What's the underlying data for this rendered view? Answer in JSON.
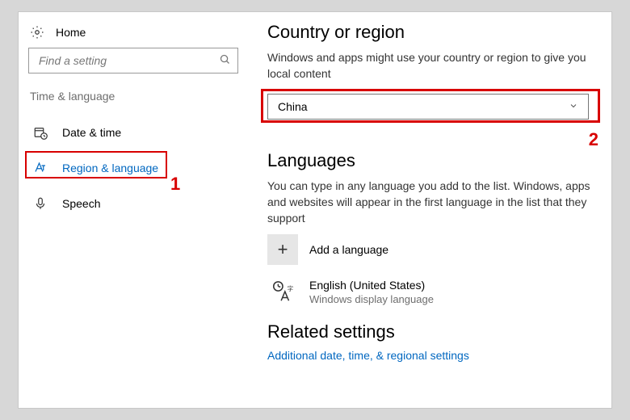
{
  "sidebar": {
    "home_label": "Home",
    "search_placeholder": "Find a setting",
    "section_label": "Time & language",
    "items": [
      {
        "label": "Date & time"
      },
      {
        "label": "Region & language"
      },
      {
        "label": "Speech"
      }
    ]
  },
  "content": {
    "country_heading": "Country or region",
    "country_desc": "Windows and apps might use your country or region to give you local content",
    "country_value": "China",
    "languages_heading": "Languages",
    "languages_desc": "You can type in any language you add to the list. Windows, apps and websites will appear in the first language in the list that they support",
    "add_language_label": "Add a language",
    "lang_name": "English (United States)",
    "lang_sub": "Windows display language",
    "related_heading": "Related settings",
    "related_link": "Additional date, time, & regional settings"
  },
  "callouts": {
    "num1": "1",
    "num2": "2"
  }
}
